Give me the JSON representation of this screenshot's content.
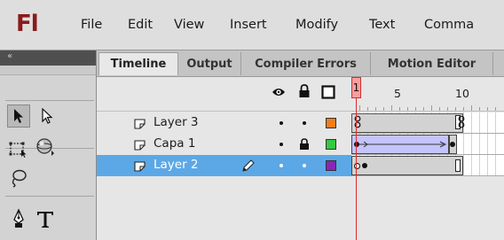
{
  "menubar": {
    "logo": "Fl",
    "items": [
      "File",
      "Edit",
      "View",
      "Insert",
      "Modify",
      "Text",
      "Comma"
    ]
  },
  "tools_panel": {
    "collapse_glyph": "«",
    "tools": [
      "selection-tool",
      "subselection-tool",
      "free-transform-tool",
      "3d-rotation-tool",
      "lasso-tool",
      "pen-tool",
      "text-tool"
    ]
  },
  "tabs": [
    {
      "label": "Timeline",
      "active": true
    },
    {
      "label": "Output",
      "active": false
    },
    {
      "label": "Compiler Errors",
      "active": false
    },
    {
      "label": "Motion Editor",
      "active": false
    }
  ],
  "timeline": {
    "header_icons": [
      "eye-icon",
      "lock-icon",
      "outline-icon"
    ],
    "frame_labels": [
      "1",
      "5",
      "10"
    ],
    "playhead_frame": "1",
    "layers": [
      {
        "name": "Layer 3",
        "selected": false,
        "locked": false,
        "color": "#f07e1e",
        "editing": false
      },
      {
        "name": "Capa 1",
        "selected": false,
        "locked": true,
        "color": "#35c840",
        "editing": false
      },
      {
        "name": "Layer 2",
        "selected": true,
        "locked": false,
        "color": "#8a26b4",
        "editing": true
      }
    ]
  },
  "colors": {
    "selection": "#5ca8e6",
    "playhead": "#e02a2a",
    "tween": "#c4c4ff",
    "tools_header": "#4f4f4f"
  }
}
